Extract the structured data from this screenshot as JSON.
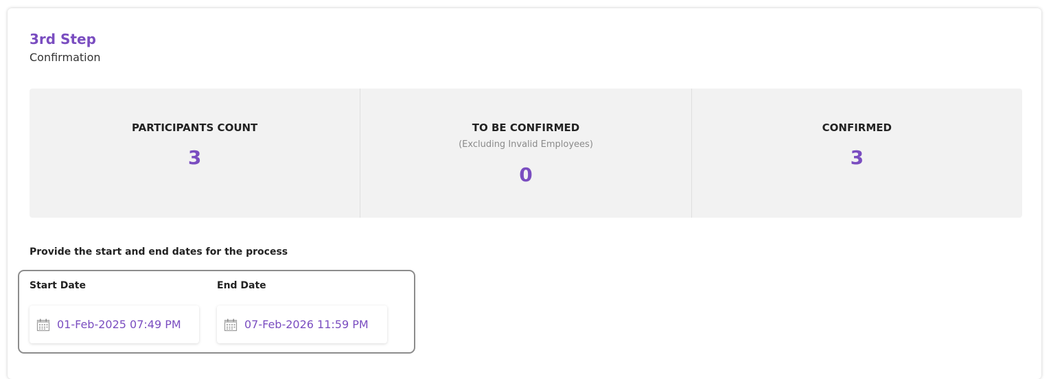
{
  "step": {
    "title": "3rd Step",
    "subtitle": "Confirmation"
  },
  "stats": [
    {
      "label": "PARTICIPANTS COUNT",
      "note": "",
      "value": "3"
    },
    {
      "label": "TO BE CONFIRMED",
      "note": "(Excluding Invalid Employees)",
      "value": "0"
    },
    {
      "label": "CONFIRMED",
      "note": "",
      "value": "3"
    }
  ],
  "dates": {
    "instructions": "Provide the start and end dates for the process",
    "start": {
      "label": "Start Date",
      "value": "01-Feb-2025 07:49 PM",
      "icon": "calendar-icon"
    },
    "end": {
      "label": "End Date",
      "value": "07-Feb-2026 11:59 PM",
      "icon": "calendar-icon"
    }
  },
  "colors": {
    "accent": "#7a4dc0",
    "panel": "#f2f2f2",
    "highlight_border": "#8c8c8c"
  }
}
